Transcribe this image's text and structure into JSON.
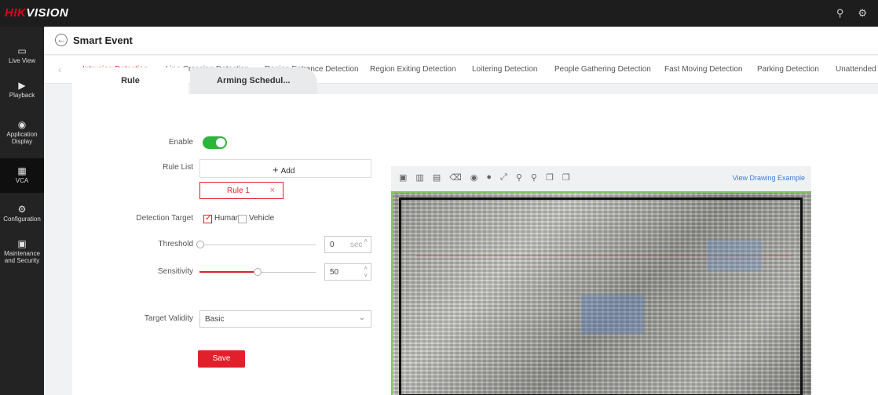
{
  "app": {
    "logo_red": "HIK",
    "logo_white": "VISION"
  },
  "topbar": {
    "icons": [
      "search-icon",
      "settings-icon"
    ]
  },
  "sidebar": {
    "items": [
      {
        "label": "Live View",
        "icon": "monitor-icon"
      },
      {
        "label": "Playback",
        "icon": "play-icon"
      },
      {
        "label": "Application Display",
        "icon": "application-icon"
      },
      {
        "label": "VCA",
        "icon": "grid-icon"
      },
      {
        "label": "Configuration",
        "icon": "gear-icon"
      },
      {
        "label": "Maintenance and Security",
        "icon": "shield-icon"
      }
    ],
    "active": "VCA"
  },
  "header": {
    "title": "Smart Event"
  },
  "detection_tabs": [
    "Intrusion Detection",
    "Line Crossing Detection",
    "Region Entrance Detection",
    "Region Exiting Detection",
    "Loitering Detection",
    "People Gathering Detection",
    "Fast Moving Detection",
    "Parking Detection",
    "Unattended B"
  ],
  "active_detection_tab": "Intrusion Detection",
  "sub_tabs": {
    "rule": "Rule",
    "arming": "Arming Schedul..."
  },
  "form": {
    "enable_label": "Enable",
    "enable_value": true,
    "rule_list_label": "Rule List",
    "add_label": "Add",
    "rule_item": "Rule 1",
    "detection_target_label": "Detection Target",
    "targets": [
      {
        "label": "Human",
        "checked": true
      },
      {
        "label": "Vehicle",
        "checked": false
      }
    ],
    "threshold_label": "Threshold",
    "threshold_value": "0",
    "threshold_unit": "sec",
    "threshold_fraction": 0,
    "sensitivity_label": "Sensitivity",
    "sensitivity_value": "50",
    "sensitivity_fraction": 0.5,
    "target_validity_label": "Target Validity",
    "target_validity_value": "Basic",
    "save_label": "Save"
  },
  "video": {
    "toolbar_icons": [
      "snapshot-icon",
      "draw-area-icon",
      "copy-icon",
      "delete-icon",
      "camera-icon",
      "record-icon",
      "fullscreen-icon",
      "zoom-in-icon",
      "zoom-out-icon",
      "window-icon",
      "window-alt-icon"
    ],
    "view_example_link": "View Drawing Example"
  }
}
